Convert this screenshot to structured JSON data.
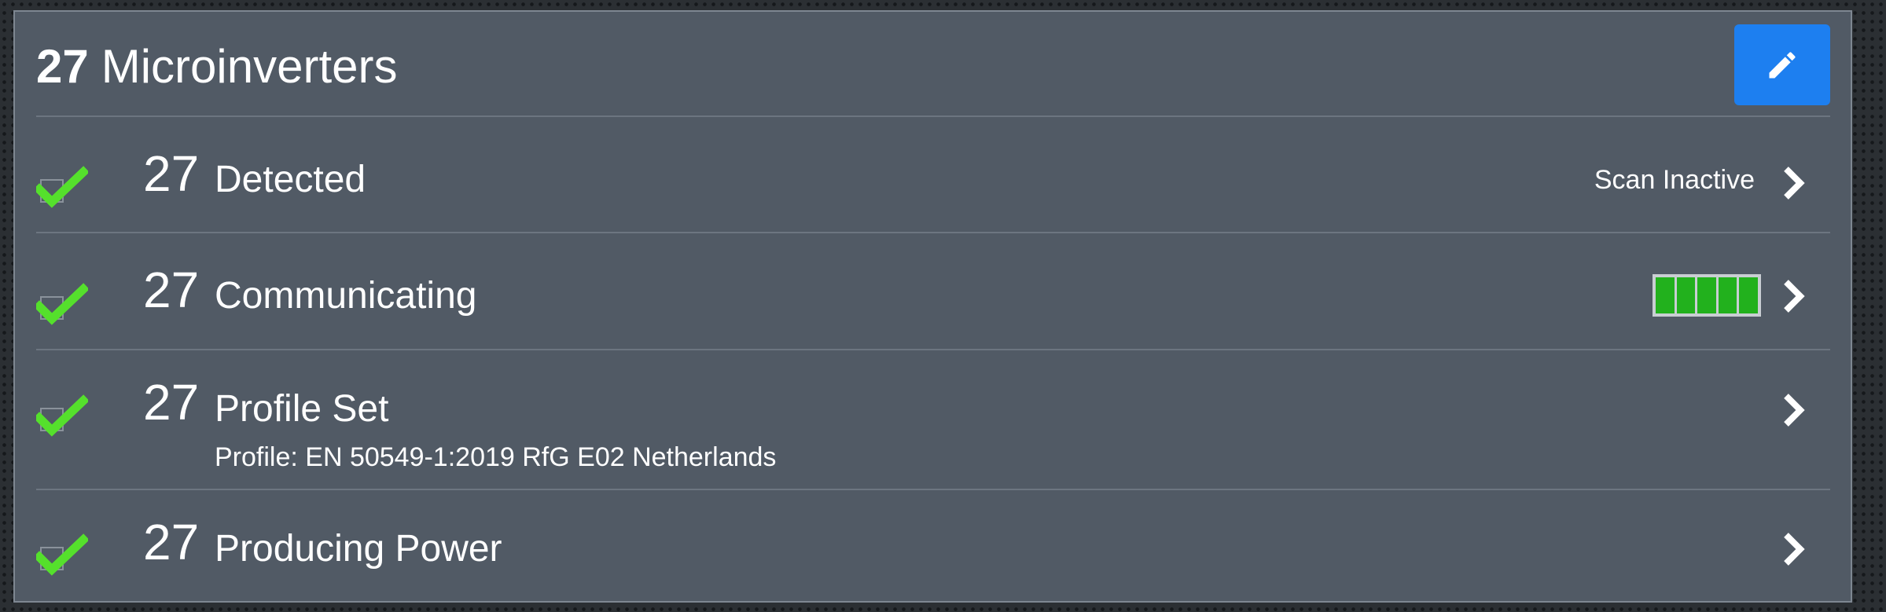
{
  "header": {
    "count": "27",
    "title": "Microinverters",
    "edit_icon": "pencil-icon"
  },
  "rows": [
    {
      "count": "27",
      "label": "Detected",
      "status": "Scan Inactive",
      "check_icon": "checkmark-icon",
      "chevron_icon": "chevron-right-icon"
    },
    {
      "count": "27",
      "label": "Communicating",
      "signal_level": 5,
      "signal_max": 5,
      "check_icon": "checkmark-icon",
      "chevron_icon": "chevron-right-icon"
    },
    {
      "count": "27",
      "label": "Profile Set",
      "subtext": "Profile: EN 50549-1:2019 RfG E02 Netherlands",
      "check_icon": "checkmark-icon",
      "chevron_icon": "chevron-right-icon"
    },
    {
      "count": "27",
      "label": "Producing Power",
      "check_icon": "checkmark-icon",
      "chevron_icon": "chevron-right-icon"
    }
  ],
  "colors": {
    "panel_bg": "#515a65",
    "accent_blue": "#1d7ff0",
    "check_green": "#55e02c",
    "signal_green": "#22b11d"
  }
}
